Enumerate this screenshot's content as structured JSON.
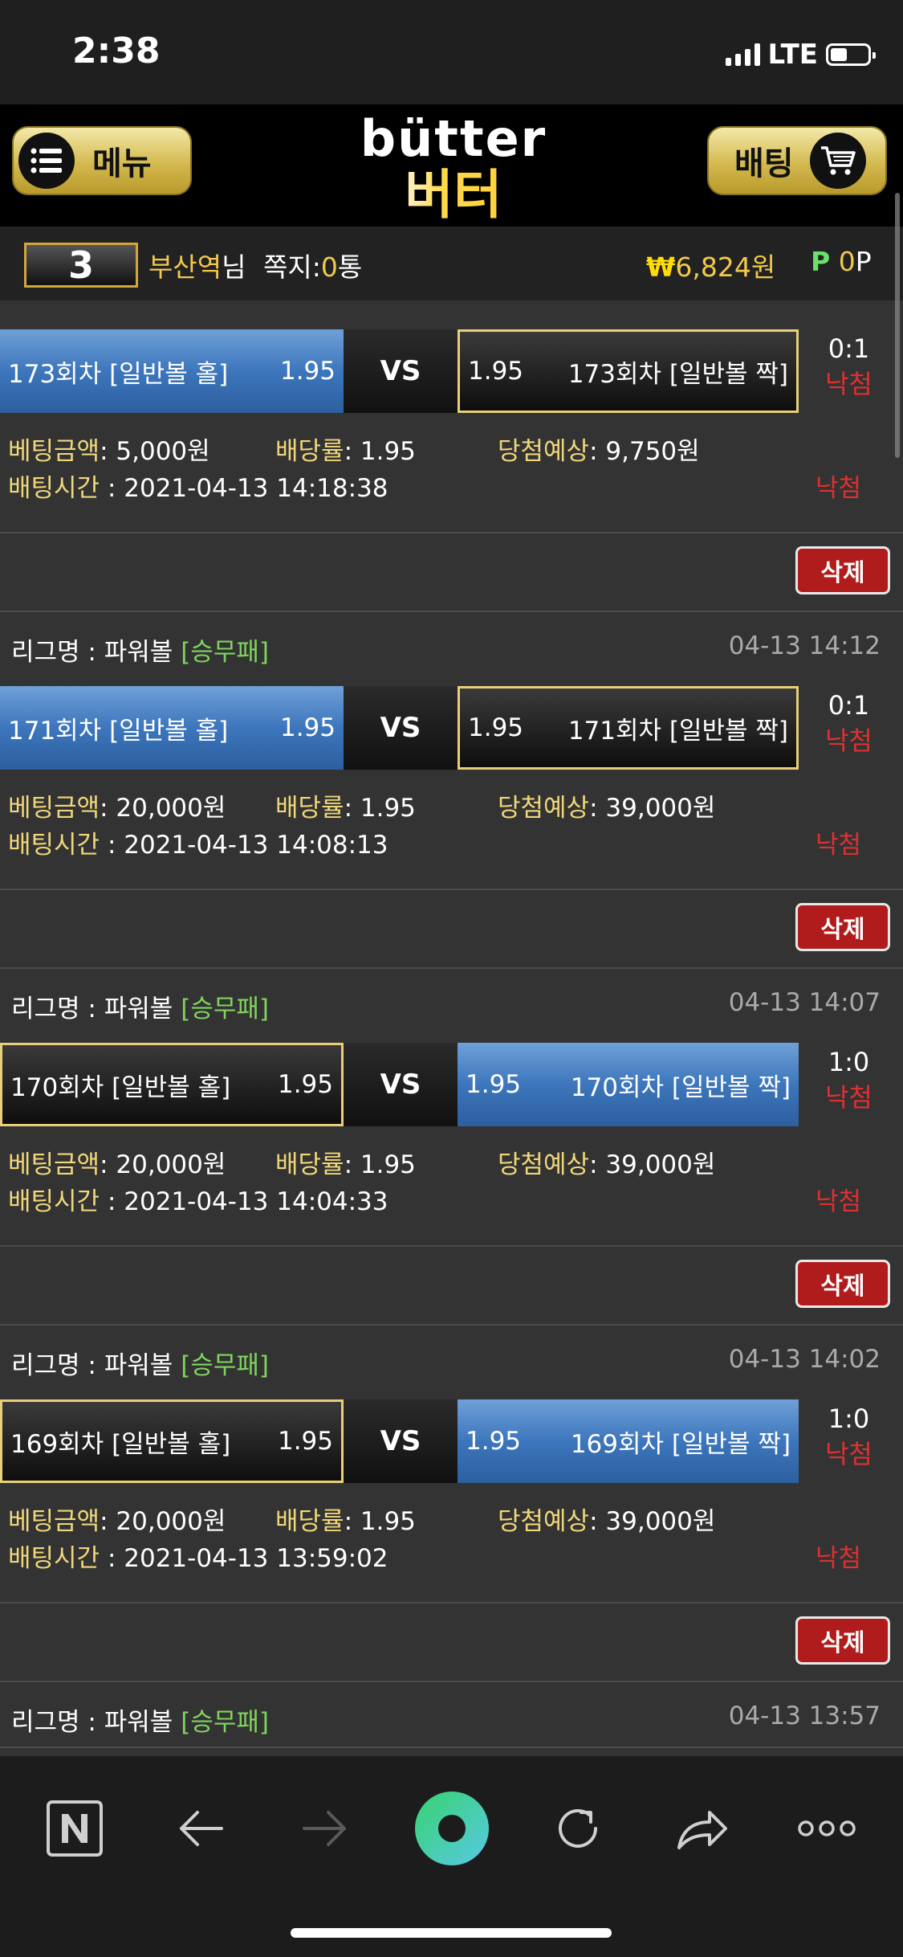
{
  "status_bar": {
    "time": "2:38",
    "network": "LTE",
    "battery_level": 0.45
  },
  "header": {
    "menu_label": "메뉴",
    "logo_en": "bütter",
    "logo_ko": "버터",
    "bet_label": "배팅"
  },
  "user": {
    "level": "3",
    "name": "부산역",
    "name_suffix": "님",
    "note_label": "쪽지:",
    "note_count": "0",
    "note_unit": "통",
    "money_symbol": "₩",
    "money": "6,824원",
    "point_symbol": "P",
    "point": "0",
    "point_unit": "P"
  },
  "labels": {
    "league_prefix": "리그명 : ",
    "amount": "베팅금액",
    "odds": "배당률",
    "expected": "당첨예상",
    "bet_time": "배팅시간",
    "delete": "삭제",
    "vs": "VS"
  },
  "bets": [
    {
      "league": "",
      "tag": "",
      "datetime": "",
      "home": "173회차 [일반볼 홀]",
      "home_odds": "1.95",
      "away": "173회차 [일반볼 짝]",
      "away_odds": "1.95",
      "selected": "home",
      "score": "0:1",
      "result": "낙첨",
      "amount": ": 5,000원",
      "odds": ": 1.95",
      "expected": ": 9,750원",
      "bet_time": " : 2021-04-13 14:18:38",
      "status": "낙첨"
    },
    {
      "league": "파워볼",
      "tag": "[승무패]",
      "datetime": "04-13 14:12",
      "home": "171회차 [일반볼 홀]",
      "home_odds": "1.95",
      "away": "171회차 [일반볼 짝]",
      "away_odds": "1.95",
      "selected": "home",
      "score": "0:1",
      "result": "낙첨",
      "amount": ": 20,000원",
      "odds": ": 1.95",
      "expected": ": 39,000원",
      "bet_time": " : 2021-04-13 14:08:13",
      "status": "낙첨"
    },
    {
      "league": "파워볼",
      "tag": "[승무패]",
      "datetime": "04-13 14:07",
      "home": "170회차 [일반볼 홀]",
      "home_odds": "1.95",
      "away": "170회차 [일반볼 짝]",
      "away_odds": "1.95",
      "selected": "away",
      "score": "1:0",
      "result": "낙첨",
      "amount": ": 20,000원",
      "odds": ": 1.95",
      "expected": ": 39,000원",
      "bet_time": " : 2021-04-13 14:04:33",
      "status": "낙첨"
    },
    {
      "league": "파워볼",
      "tag": "[승무패]",
      "datetime": "04-13 14:02",
      "home": "169회차 [일반볼 홀]",
      "home_odds": "1.95",
      "away": "169회차 [일반볼 짝]",
      "away_odds": "1.95",
      "selected": "away",
      "score": "1:0",
      "result": "낙첨",
      "amount": ": 20,000원",
      "odds": ": 1.95",
      "expected": ": 39,000원",
      "bet_time": " : 2021-04-13 13:59:02",
      "status": "낙첨"
    }
  ],
  "next_league": {
    "league": "파워볼",
    "tag": "[승무패]",
    "datetime": "04-13 13:57"
  },
  "browser_bar": {
    "icons": [
      "naver-n-icon",
      "back-arrow-icon",
      "forward-arrow-icon",
      "home-circle-icon",
      "refresh-icon",
      "share-icon",
      "more-icon"
    ]
  },
  "colors": {
    "accent_gold": "#f2c94c",
    "selected_blue": "#3d76bc",
    "lose_red": "#e03030",
    "tag_green": "#7fd45f",
    "delete_red": "#b01c1c"
  }
}
